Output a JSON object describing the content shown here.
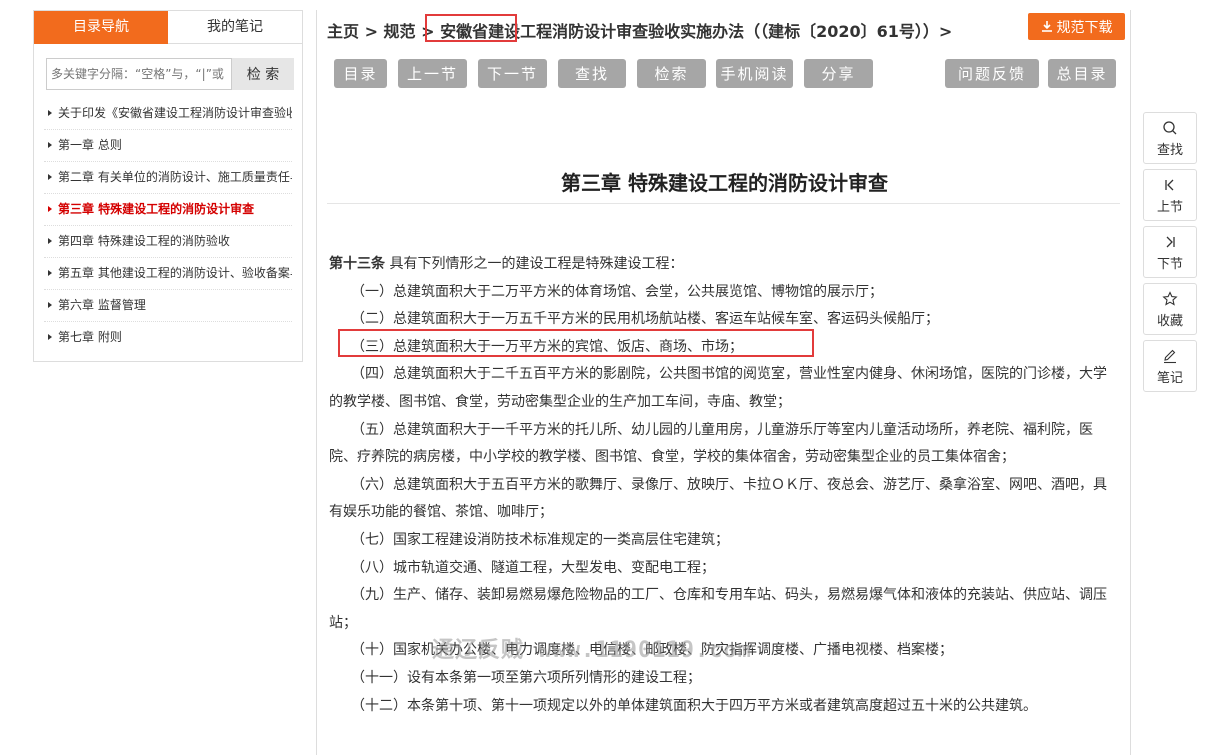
{
  "sidebar": {
    "tabs": [
      {
        "label": "目录导航",
        "active": true
      },
      {
        "label": "我的笔记",
        "active": false
      }
    ],
    "search": {
      "placeholder": "多关键字分隔：“空格”与，“|”或",
      "button": "检 索"
    },
    "toc": [
      {
        "label": "关于印发《安徽省建设工程消防设计审查验收实施办法》的通知"
      },
      {
        "label": "第一章 总则"
      },
      {
        "label": "第二章 有关单位的消防设计、施工质量责任与义务"
      },
      {
        "label": "第三章 特殊建设工程的消防设计审查",
        "current": true
      },
      {
        "label": "第四章 特殊建设工程的消防验收"
      },
      {
        "label": "第五章 其他建设工程的消防设计、验收备案与抽查"
      },
      {
        "label": "第六章 监督管理"
      },
      {
        "label": "第七章 附则"
      }
    ]
  },
  "breadcrumb": {
    "text": "主页 > 规范 > 安徽省建设工程消防设计审查验收实施办法（（建标〔2020〕61号））>"
  },
  "download": {
    "label": "规范下载",
    "icon": "download-icon"
  },
  "toolbar": {
    "buttons": [
      {
        "label": "目录",
        "name": "catalog-button"
      },
      {
        "label": "上一节",
        "name": "prev-section-button"
      },
      {
        "label": "下一节",
        "name": "next-section-button"
      },
      {
        "label": "查找",
        "name": "find-button"
      },
      {
        "label": "检索",
        "name": "search-button"
      },
      {
        "label": "手机阅读",
        "name": "mobile-read-button"
      },
      {
        "label": "分享",
        "name": "share-button"
      },
      {
        "label": "问题反馈",
        "name": "feedback-button"
      },
      {
        "label": "总目录",
        "name": "main-catalog-button"
      }
    ]
  },
  "chapter": {
    "title": "第三章 特殊建设工程的消防设计审查"
  },
  "article": {
    "lead": "第十三条",
    "lead_text": " 具有下列情形之一的建设工程是特殊建设工程：",
    "items": [
      "（一）总建筑面积大于二万平方米的体育场馆、会堂，公共展览馆、博物馆的展示厅；",
      "（二）总建筑面积大于一万五千平方米的民用机场航站楼、客运车站候车室、客运码头候船厅；",
      "（三）总建筑面积大于一万平方米的宾馆、饭店、商场、市场；",
      "（四）总建筑面积大于二千五百平方米的影剧院，公共图书馆的阅览室，营业性室内健身、休闲场馆，医院的门诊楼，大学的教学楼、图书馆、食堂，劳动密集型企业的生产加工车间，寺庙、教堂；",
      "（五）总建筑面积大于一千平方米的托儿所、幼儿园的儿童用房，儿童游乐厅等室内儿童活动场所，养老院、福利院，医院、疗养院的病房楼，中小学校的教学楼、图书馆、食堂，学校的集体宿舍，劳动密集型企业的员工集体宿舍；",
      "（六）总建筑面积大于五百平方米的歌舞厅、录像厅、放映厅、卡拉ＯＫ厅、夜总会、游艺厅、桑拿浴室、网吧、酒吧，具有娱乐功能的餐馆、茶馆、咖啡厅；",
      "（七）国家工程建设消防技术标准规定的一类高层住宅建筑；",
      "（八）城市轨道交通、隧道工程，大型发电、变配电工程；",
      "（九）生产、储存、装卸易燃易爆危险物品的工厂、仓库和专用车站、码头，易燃易爆气体和液体的充装站、供应站、调压站；",
      "（十）国家机关办公楼、电力调度楼、电信楼、邮政楼、防灾指挥调度楼、广播电视楼、档案楼；",
      "（十一）设有本条第一项至第六项所列情形的建设工程；",
      "（十二）本条第十项、第十一项规定以外的单体建筑面积大于四万平方米或者建筑高度超过五十米的公共建筑。"
    ]
  },
  "watermark": "通辽反贼 www.1190119.com",
  "float_tools": [
    {
      "label": "查找",
      "icon": "search-icon"
    },
    {
      "label": "上节",
      "icon": "prev-icon"
    },
    {
      "label": "下节",
      "icon": "next-icon"
    },
    {
      "label": "收藏",
      "icon": "star-icon"
    },
    {
      "label": "笔记",
      "icon": "pencil-icon"
    }
  ],
  "colors": {
    "accent": "#f26b1d",
    "highlight": "#e23b3b",
    "current": "#d40000",
    "tool_button": "#a6a6a6"
  }
}
